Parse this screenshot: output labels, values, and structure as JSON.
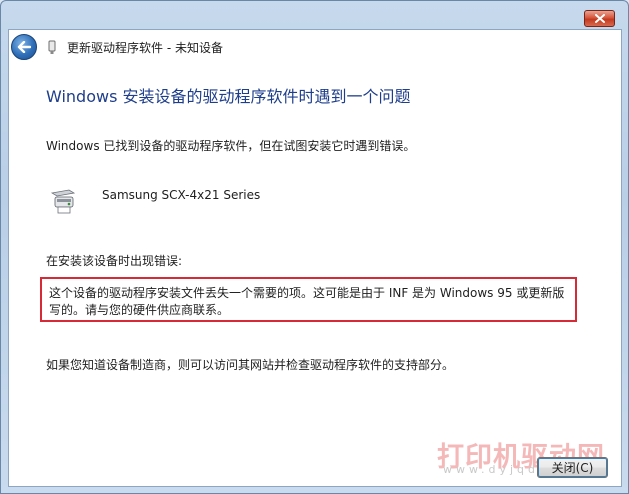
{
  "window": {
    "nav_title": "更新驱动程序软件 - 未知设备",
    "close_icon": "close-x-icon"
  },
  "header": {
    "back_icon": "back-arrow-icon"
  },
  "main": {
    "title": "Windows 安装设备的驱动程序软件时遇到一个问题",
    "description": "Windows 已找到设备的驱动程序软件，但在试图安装它时遇到错误。",
    "device": {
      "icon": "printer-icon",
      "name": "Samsung SCX-4x21 Series"
    },
    "error_label": "在安装该设备时出现错误:",
    "error_message_line1": "这个设备的驱动程序安装文件丢失一个需要的项。这可能是由于 INF 是为 Windows 95 或更新版",
    "error_message_line2": "写的。请与您的硬件供应商联系。",
    "help_text": "如果您知道设备制造商，则可以访问其网站并检查驱动程序软件的支持部分。"
  },
  "footer": {
    "close_label": "关闭(C)"
  },
  "watermark": {
    "text": "打印机驱动网",
    "url": "www.dyjqd.com"
  },
  "colors": {
    "title_blue": "#1e3e8c",
    "error_border": "#d62b36",
    "close_button_red": "#c23a1f"
  }
}
